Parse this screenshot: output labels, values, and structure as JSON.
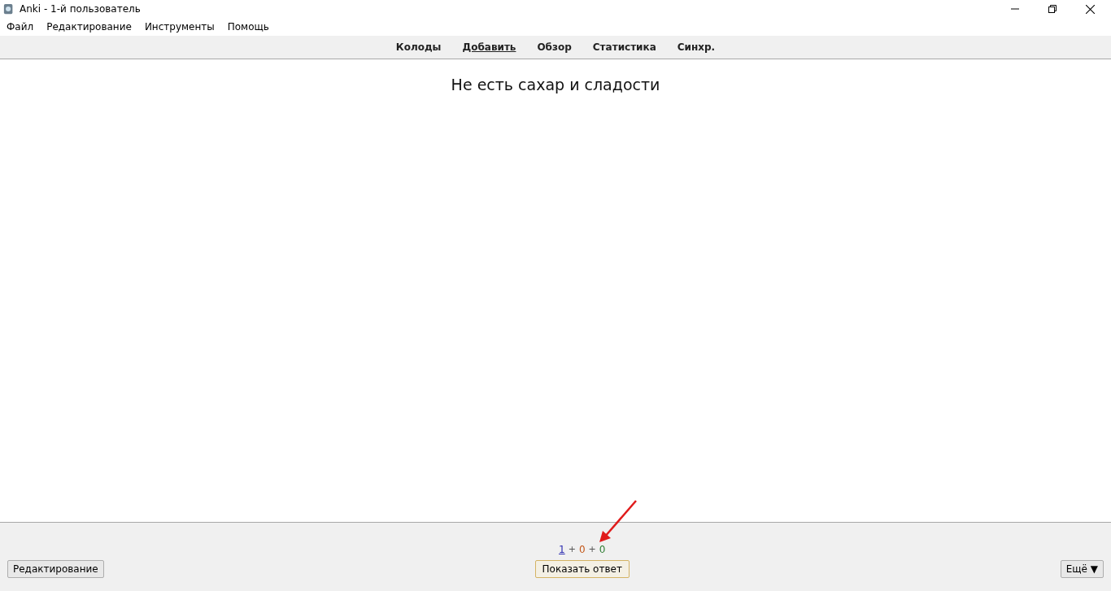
{
  "window": {
    "title": "Anki - 1-й пользователь"
  },
  "menu": [
    "Файл",
    "Редактирование",
    "Инструменты",
    "Помощь"
  ],
  "nav": [
    {
      "label": "Колоды",
      "selected": false
    },
    {
      "label": "Добавить",
      "selected": true
    },
    {
      "label": "Обзор",
      "selected": false
    },
    {
      "label": "Статистика",
      "selected": false
    },
    {
      "label": "Синхр.",
      "selected": false
    }
  ],
  "card": {
    "question": "Не есть сахар и сладости"
  },
  "counts": [
    {
      "kind": "count",
      "text": "1",
      "color": "#2b2bb0",
      "selected": true
    },
    {
      "kind": "plus",
      "text": "+"
    },
    {
      "kind": "count",
      "text": "0",
      "color": "#c35617",
      "selected": false
    },
    {
      "kind": "plus",
      "text": "+"
    },
    {
      "kind": "count",
      "text": "0",
      "color": "#2e7d32",
      "selected": false
    }
  ],
  "bottom": {
    "edit_button": "Редактирование",
    "show_answer_button": "Показать ответ",
    "more_button": "Ещё",
    "more_caret": "▼"
  }
}
